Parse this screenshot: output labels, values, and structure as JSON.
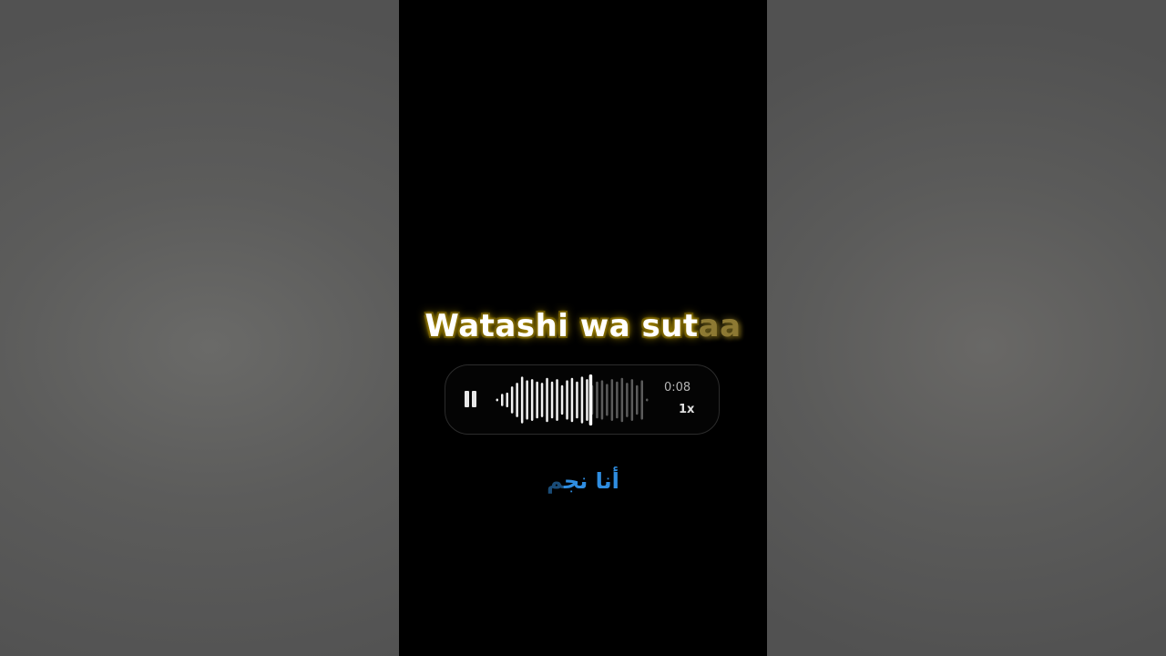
{
  "lyric": {
    "sung": "Watashi wa sut",
    "unsung": "aa"
  },
  "voice_message": {
    "state": "playing",
    "duration": "0:08",
    "speed": "1x",
    "progress": 0.6,
    "waveform_levels": [
      0.05,
      0.25,
      0.3,
      0.55,
      0.7,
      0.95,
      0.8,
      0.85,
      0.75,
      0.7,
      0.9,
      0.75,
      0.85,
      0.6,
      0.8,
      0.9,
      0.75,
      0.95,
      0.85,
      0.6,
      0.75,
      0.8,
      0.65,
      0.85,
      0.75,
      0.9,
      0.7,
      0.85,
      0.6,
      0.8,
      0.05
    ],
    "colors": {
      "played": "#f2f2f2",
      "unplayed": "#5c5c5c",
      "border": "#2c2c2c"
    }
  },
  "translation": {
    "sung": "أنا نج",
    "unsung": "م"
  }
}
